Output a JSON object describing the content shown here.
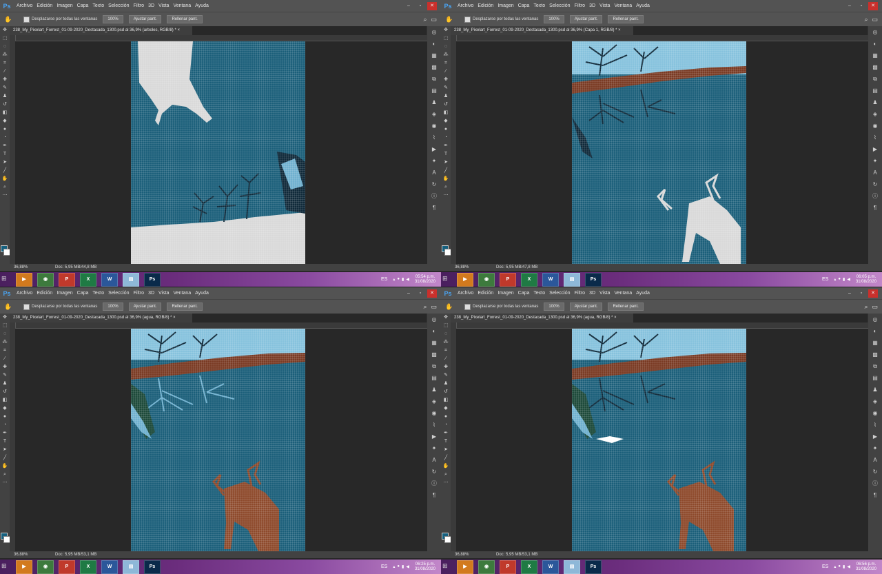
{
  "menu": [
    "Archivo",
    "Edición",
    "Imagen",
    "Capa",
    "Texto",
    "Selección",
    "Filtro",
    "3D",
    "Vista",
    "Ventana",
    "Ayuda"
  ],
  "options": {
    "scroll_all_label": "Desplazarse por todas las ventanas",
    "zoom_btn": "100%",
    "fit_btn": "Ajustar pant.",
    "fill_btn": "Rellenar pant."
  },
  "colors": {
    "water": "#1b5f7a",
    "sky": "#86c2dd",
    "bank": "#7a3b24",
    "deer_silhouette": "#d9d9d9",
    "deer_brown": "#8e4a2c",
    "tree_dark": "#102a3a"
  },
  "panes": [
    {
      "doc_tab": "238_My_Pixelart_Forrest_01-09-2020_Destacada_1300.psd al 36,9% (arboles, RGB/8) *",
      "zoom": "36,88%",
      "doc_size": "Doc: 5,95 MB/44,8 MB",
      "time": "05:54 p.m.",
      "date": "31/08/2020"
    },
    {
      "doc_tab": "238_My_Pixelart_Forrest_01-09-2020_Destacada_1300.psd al 36,9% (Capa 1, RGB/8) *",
      "zoom": "36,88%",
      "doc_size": "Doc: 5,95 MB/47,8 MB",
      "time": "06:05 p.m.",
      "date": "31/08/2020"
    },
    {
      "doc_tab": "238_My_Pixelart_Forrest_01-09-2020_Destacada_1300.psd al 36,9% (agua, RGB/8) *",
      "zoom": "36,88%",
      "doc_size": "Doc: 5,95 MB/53,1 MB",
      "time": "06:25 p.m.",
      "date": "31/08/2020"
    },
    {
      "doc_tab": "238_My_Pixelart_Forrest_01-09-2020_Destacada_1300.psd al 36,9% (agua, RGB/8) *",
      "zoom": "36,88%",
      "doc_size": "Doc: 5,95 MB/53,1 MB",
      "time": "06:56 p.m.",
      "date": "31/08/2020"
    }
  ],
  "taskbar": {
    "apps": [
      "Media Player",
      "Chrome",
      "PDF",
      "Excel",
      "Word",
      "Notepad",
      "Photoshop"
    ],
    "lang": "ES"
  }
}
